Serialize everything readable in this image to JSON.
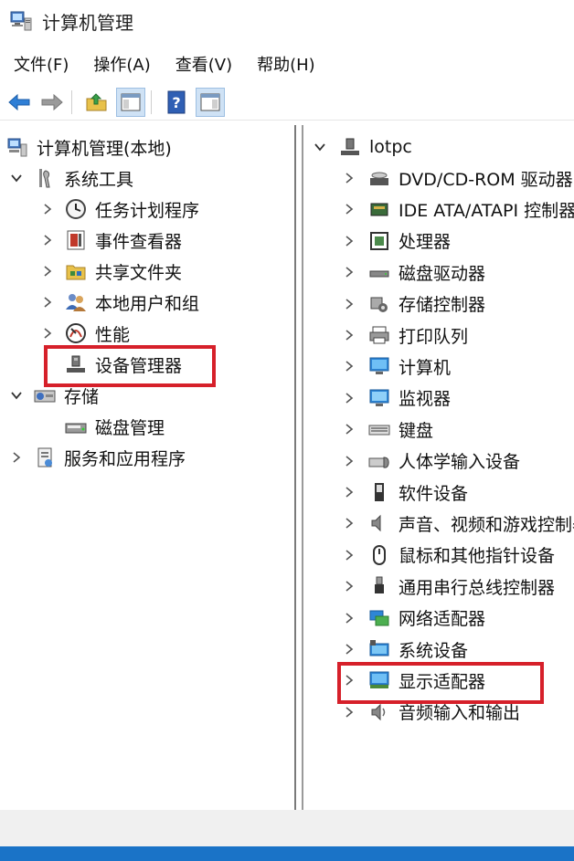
{
  "window": {
    "title": "计算机管理"
  },
  "menu": [
    {
      "label": "文件(F)"
    },
    {
      "label": "操作(A)"
    },
    {
      "label": "查看(V)"
    },
    {
      "label": "帮助(H)"
    }
  ],
  "toolbar": {
    "buttons": [
      {
        "icon": "back-arrow-icon"
      },
      {
        "icon": "forward-arrow-icon"
      },
      {
        "icon": "up-folder-icon"
      },
      {
        "icon": "show-hide-console-tree-icon"
      },
      {
        "icon": "help-icon"
      },
      {
        "icon": "show-hide-action-pane-icon"
      }
    ]
  },
  "left_tree": [
    {
      "label": "计算机管理(本地)",
      "icon": "computer-management-icon",
      "level": 0,
      "chevron": "none"
    },
    {
      "label": "系统工具",
      "icon": "tools-icon",
      "level": 0,
      "chevron": "expanded"
    },
    {
      "label": "任务计划程序",
      "icon": "clock-icon",
      "level": 1,
      "chevron": "collapsed"
    },
    {
      "label": "事件查看器",
      "icon": "event-viewer-icon",
      "level": 1,
      "chevron": "collapsed"
    },
    {
      "label": "共享文件夹",
      "icon": "shared-folder-icon",
      "level": 1,
      "chevron": "collapsed"
    },
    {
      "label": "本地用户和组",
      "icon": "users-icon",
      "level": 1,
      "chevron": "collapsed"
    },
    {
      "label": "性能",
      "icon": "performance-icon",
      "level": 1,
      "chevron": "collapsed"
    },
    {
      "label": "设备管理器",
      "icon": "device-manager-icon",
      "level": 1,
      "chevron": "none",
      "highlighted": true
    },
    {
      "label": "存储",
      "icon": "storage-icon",
      "level": 0,
      "chevron": "expanded"
    },
    {
      "label": "磁盘管理",
      "icon": "disk-management-icon",
      "level": 1,
      "chevron": "none"
    },
    {
      "label": "服务和应用程序",
      "icon": "services-icon",
      "level": 0,
      "chevron": "collapsed"
    }
  ],
  "right_tree": {
    "root": {
      "label": "lotpc",
      "icon": "computer-root-icon"
    },
    "items": [
      {
        "label": "DVD/CD-ROM 驱动器",
        "icon": "dvd-drive-icon"
      },
      {
        "label": "IDE ATA/ATAPI 控制器",
        "icon": "ide-controller-icon"
      },
      {
        "label": "处理器",
        "icon": "processor-icon"
      },
      {
        "label": "磁盘驱动器",
        "icon": "disk-drive-icon"
      },
      {
        "label": "存储控制器",
        "icon": "storage-controller-icon"
      },
      {
        "label": "打印队列",
        "icon": "printer-icon"
      },
      {
        "label": "计算机",
        "icon": "computer-icon"
      },
      {
        "label": "监视器",
        "icon": "monitor-icon"
      },
      {
        "label": "键盘",
        "icon": "keyboard-icon"
      },
      {
        "label": "人体学输入设备",
        "icon": "hid-icon"
      },
      {
        "label": "软件设备",
        "icon": "software-device-icon"
      },
      {
        "label": "声音、视频和游戏控制器",
        "icon": "sound-icon"
      },
      {
        "label": "鼠标和其他指针设备",
        "icon": "mouse-icon"
      },
      {
        "label": "通用串行总线控制器",
        "icon": "usb-icon"
      },
      {
        "label": "网络适配器",
        "icon": "network-adapter-icon"
      },
      {
        "label": "系统设备",
        "icon": "system-device-icon"
      },
      {
        "label": "显示适配器",
        "icon": "display-adapter-icon",
        "highlighted": true
      },
      {
        "label": "音频输入和输出",
        "icon": "audio-io-icon"
      }
    ]
  },
  "colors": {
    "highlight_box": "#d6202a",
    "bottom_bar": "#1a73c7"
  }
}
